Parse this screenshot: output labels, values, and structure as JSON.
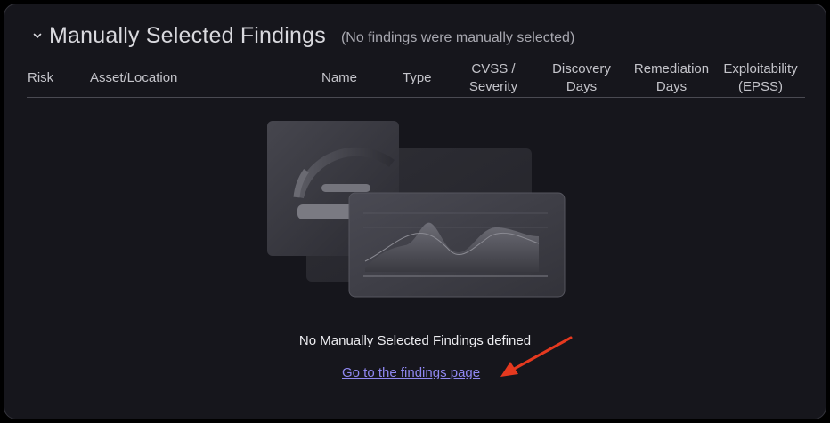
{
  "section": {
    "title": "Manually Selected Findings",
    "subtitle": "(No findings were manually selected)",
    "toggle_icon": "chevron-down-icon"
  },
  "table": {
    "columns": [
      {
        "label": "Risk"
      },
      {
        "label": "Asset/Location"
      },
      {
        "label": "Name"
      },
      {
        "label": "Type"
      },
      {
        "label": "CVSS /\nSeverity"
      },
      {
        "label": "Discovery\nDays"
      },
      {
        "label": "Remediation\nDays"
      },
      {
        "label": "Exploitability\n(EPSS)"
      }
    ]
  },
  "empty_state": {
    "illustration_icon": "empty-chart-illustration",
    "message": "No Manually Selected Findings defined",
    "link_label": "Go to the findings page"
  },
  "colors": {
    "accent_link": "#8f87f0",
    "annotation_arrow": "#e5391f"
  }
}
